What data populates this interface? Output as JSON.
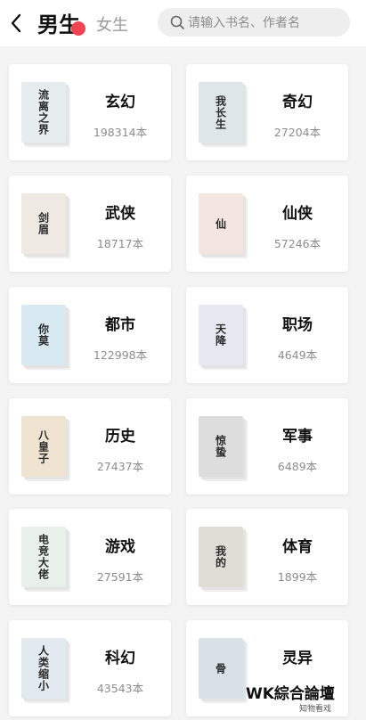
{
  "header": {
    "tab_male": "男生",
    "tab_female": "女生",
    "search_placeholder": "请输入书名、作者名"
  },
  "colors": {
    "accent_dot": "#f04550",
    "background": "#f4f4f4"
  },
  "categories": [
    {
      "name": "玄幻",
      "count": "198314本",
      "cover_text": "流离之界",
      "cover_bg": "#e7ecef"
    },
    {
      "name": "奇幻",
      "count": "27204本",
      "cover_text": "我长生",
      "cover_bg": "#dfe6ea"
    },
    {
      "name": "武侠",
      "count": "18717本",
      "cover_text": "剑眉",
      "cover_bg": "#efe9e4"
    },
    {
      "name": "仙侠",
      "count": "57246本",
      "cover_text": "仙",
      "cover_bg": "#f3e5df"
    },
    {
      "name": "都市",
      "count": "122998本",
      "cover_text": "你莫",
      "cover_bg": "#d9e9f2"
    },
    {
      "name": "职场",
      "count": "4649本",
      "cover_text": "天降",
      "cover_bg": "#e7e8f2"
    },
    {
      "name": "历史",
      "count": "27437本",
      "cover_text": "八皇子",
      "cover_bg": "#efe3d1"
    },
    {
      "name": "军事",
      "count": "6489本",
      "cover_text": "惊蛰",
      "cover_bg": "#dddddd"
    },
    {
      "name": "游戏",
      "count": "27591本",
      "cover_text": "电竞大佬",
      "cover_bg": "#e9efea"
    },
    {
      "name": "体育",
      "count": "1899本",
      "cover_text": "我的",
      "cover_bg": "#e0ddd6"
    },
    {
      "name": "科幻",
      "count": "43543本",
      "cover_text": "人类缩小",
      "cover_bg": "#e2eaf0"
    },
    {
      "name": "灵异",
      "count": "",
      "cover_text": "骨",
      "cover_bg": "#d8e1e6"
    }
  ],
  "watermark": {
    "main": "WK綜合論壇",
    "sub": "知物看戏"
  }
}
